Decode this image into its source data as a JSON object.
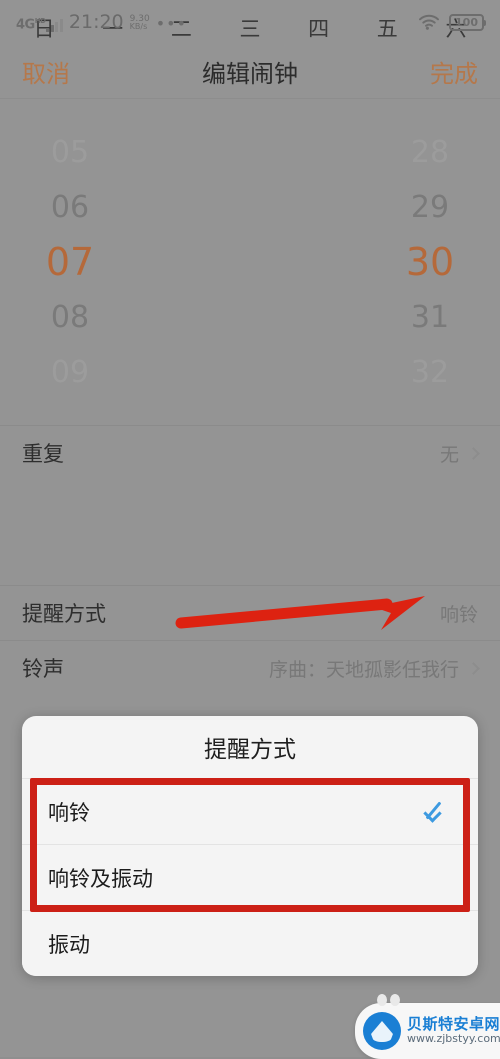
{
  "status_bar": {
    "network_type": "4G",
    "network_suffix": "HD",
    "time": "21:20",
    "speed_value": "9.30",
    "speed_unit": "KB/s",
    "overflow": "•••",
    "battery": "100"
  },
  "nav": {
    "cancel": "取消",
    "title": "编辑闹钟",
    "done": "完成"
  },
  "time_picker": {
    "hours": [
      "05",
      "06",
      "07",
      "08",
      "09"
    ],
    "selected_hour": "07",
    "minutes": [
      "28",
      "29",
      "30",
      "31",
      "32"
    ],
    "selected_minute": "30"
  },
  "rows": {
    "repeat": {
      "label": "重复",
      "value": "无"
    },
    "weekdays": [
      "日",
      "一",
      "二",
      "三",
      "四",
      "五",
      "六"
    ],
    "alert_type": {
      "label": "提醒方式",
      "value": "响铃"
    },
    "ringtone": {
      "label": "铃声",
      "value": "序曲：天地孤影任我行"
    }
  },
  "dialog": {
    "title": "提醒方式",
    "options": [
      {
        "label": "响铃",
        "checked": true
      },
      {
        "label": "响铃及振动",
        "checked": false
      },
      {
        "label": "振动",
        "checked": false
      }
    ]
  },
  "watermark": {
    "name": "贝斯特安卓网",
    "url": "www.zjbstyy.com"
  },
  "colors": {
    "accent_orange": "#b5693a",
    "annotation_red": "#cc2016",
    "check_blue": "#3d9ae0",
    "page_bg": "#949494"
  }
}
